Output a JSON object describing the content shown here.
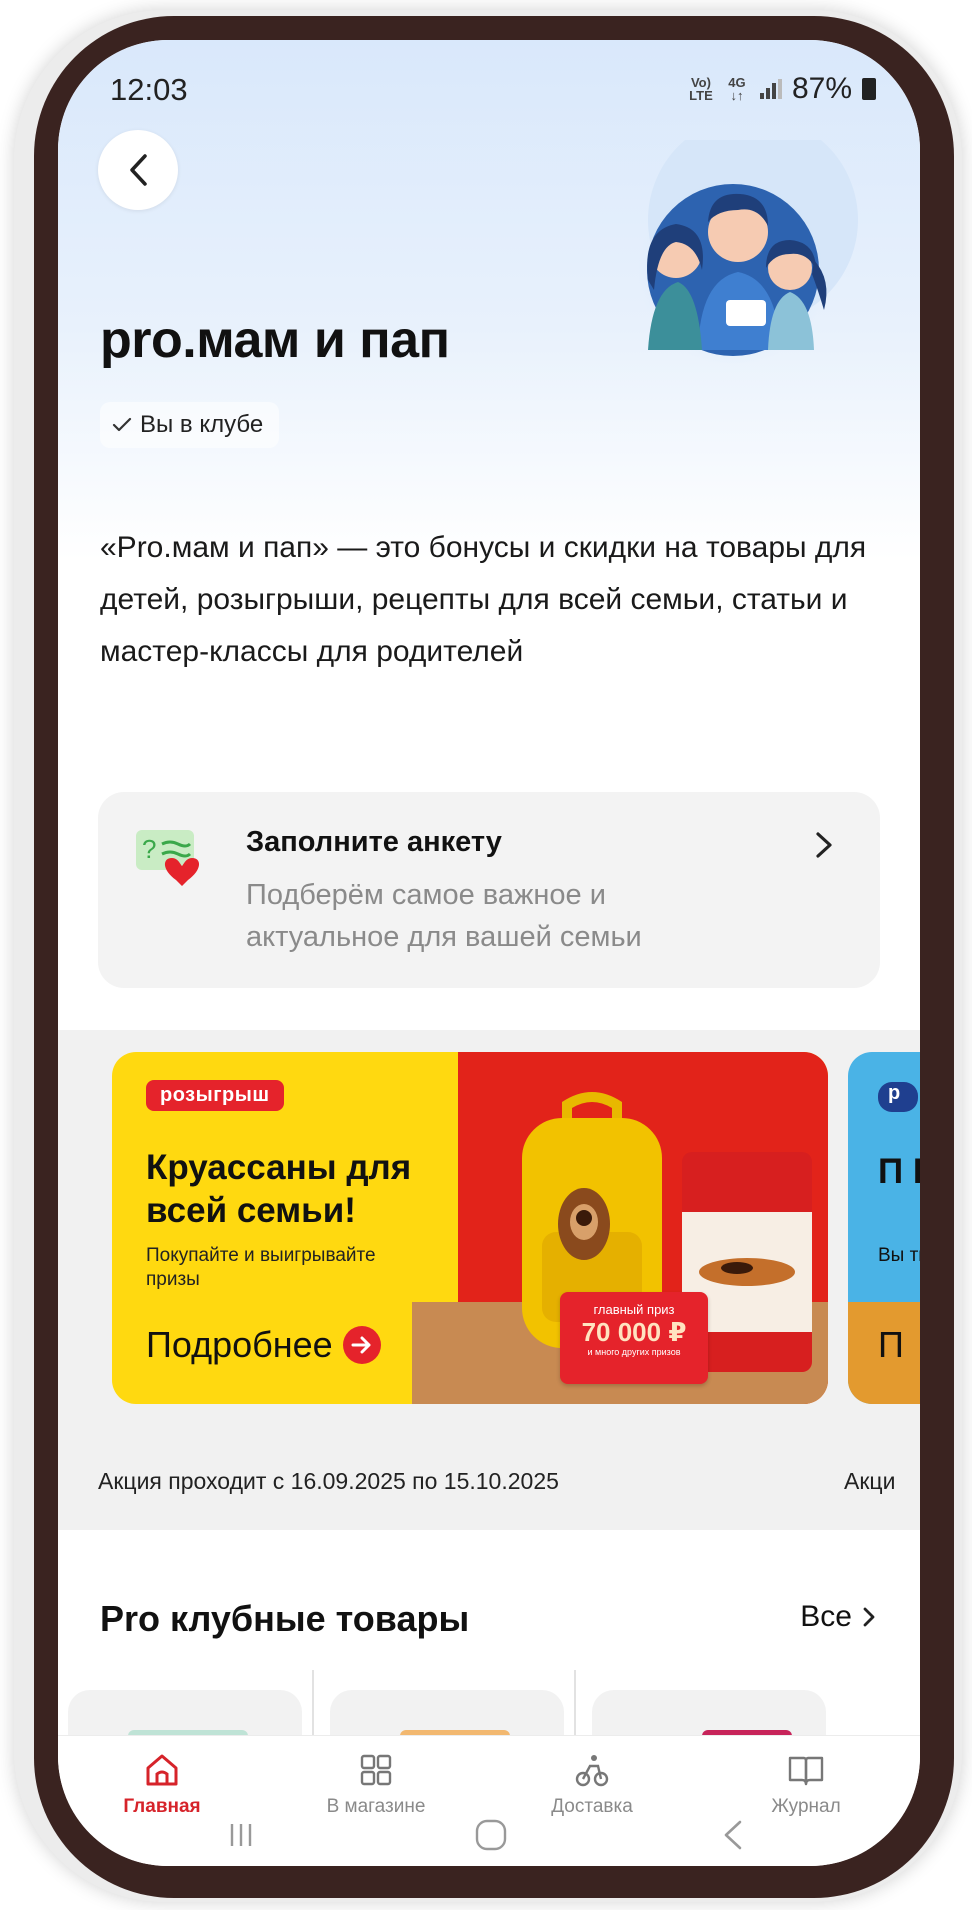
{
  "status_bar": {
    "time": "12:03",
    "net_label": "Vo) 4G LTE",
    "battery": "87%"
  },
  "header": {
    "title": "pro.мам и пап",
    "club_badge": "Вы в клубе"
  },
  "description": "«Pro.мам и пап» — это бонусы и скидки на товары для детей, розыгрыши, рецепты для всей семьи, статьи и мастер-классы для родителей",
  "survey": {
    "title": "Заполните анкету",
    "subtitle": "Подберём самое важное и актуальное для вашей семьи"
  },
  "promo": {
    "badge": "розыгрыш",
    "title": "Круассаны для всей семьи!",
    "text": "Покупайте и выигрывайте призы",
    "link": "Подробнее",
    "prize_top": "главный приз",
    "prize_amount": "70 000 ₽",
    "prize_bottom": "и много других призов",
    "dates": "Акция проходит с 16.09.2025 по 15.10.2025",
    "next_badge": "р",
    "next_title": "П Б",
    "next_text": "Вы тв",
    "next_link": "П",
    "next_dates": "Акци"
  },
  "products": {
    "title": "Pro клубные товары",
    "all_label": "Все"
  },
  "bottom_nav": {
    "items": [
      {
        "label": "Главная",
        "icon": "home-icon"
      },
      {
        "label": "В магазине",
        "icon": "grid-icon"
      },
      {
        "label": "Доставка",
        "icon": "delivery-icon"
      },
      {
        "label": "Журнал",
        "icon": "book-icon"
      }
    ]
  },
  "colors": {
    "accent_red": "#e5232b",
    "promo_yellow": "#ffd910",
    "hero_blue": "#d9e8fb"
  }
}
